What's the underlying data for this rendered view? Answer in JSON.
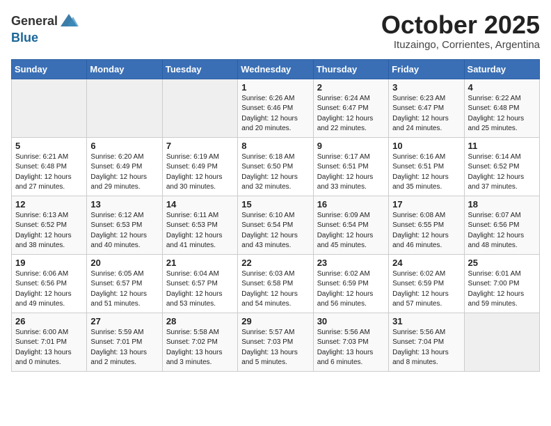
{
  "header": {
    "logo_general": "General",
    "logo_blue": "Blue",
    "month": "October 2025",
    "location": "Ituzaingo, Corrientes, Argentina"
  },
  "days_of_week": [
    "Sunday",
    "Monday",
    "Tuesday",
    "Wednesday",
    "Thursday",
    "Friday",
    "Saturday"
  ],
  "weeks": [
    [
      {
        "day": "",
        "info": ""
      },
      {
        "day": "",
        "info": ""
      },
      {
        "day": "",
        "info": ""
      },
      {
        "day": "1",
        "info": "Sunrise: 6:26 AM\nSunset: 6:46 PM\nDaylight: 12 hours\nand 20 minutes."
      },
      {
        "day": "2",
        "info": "Sunrise: 6:24 AM\nSunset: 6:47 PM\nDaylight: 12 hours\nand 22 minutes."
      },
      {
        "day": "3",
        "info": "Sunrise: 6:23 AM\nSunset: 6:47 PM\nDaylight: 12 hours\nand 24 minutes."
      },
      {
        "day": "4",
        "info": "Sunrise: 6:22 AM\nSunset: 6:48 PM\nDaylight: 12 hours\nand 25 minutes."
      }
    ],
    [
      {
        "day": "5",
        "info": "Sunrise: 6:21 AM\nSunset: 6:48 PM\nDaylight: 12 hours\nand 27 minutes."
      },
      {
        "day": "6",
        "info": "Sunrise: 6:20 AM\nSunset: 6:49 PM\nDaylight: 12 hours\nand 29 minutes."
      },
      {
        "day": "7",
        "info": "Sunrise: 6:19 AM\nSunset: 6:49 PM\nDaylight: 12 hours\nand 30 minutes."
      },
      {
        "day": "8",
        "info": "Sunrise: 6:18 AM\nSunset: 6:50 PM\nDaylight: 12 hours\nand 32 minutes."
      },
      {
        "day": "9",
        "info": "Sunrise: 6:17 AM\nSunset: 6:51 PM\nDaylight: 12 hours\nand 33 minutes."
      },
      {
        "day": "10",
        "info": "Sunrise: 6:16 AM\nSunset: 6:51 PM\nDaylight: 12 hours\nand 35 minutes."
      },
      {
        "day": "11",
        "info": "Sunrise: 6:14 AM\nSunset: 6:52 PM\nDaylight: 12 hours\nand 37 minutes."
      }
    ],
    [
      {
        "day": "12",
        "info": "Sunrise: 6:13 AM\nSunset: 6:52 PM\nDaylight: 12 hours\nand 38 minutes."
      },
      {
        "day": "13",
        "info": "Sunrise: 6:12 AM\nSunset: 6:53 PM\nDaylight: 12 hours\nand 40 minutes."
      },
      {
        "day": "14",
        "info": "Sunrise: 6:11 AM\nSunset: 6:53 PM\nDaylight: 12 hours\nand 41 minutes."
      },
      {
        "day": "15",
        "info": "Sunrise: 6:10 AM\nSunset: 6:54 PM\nDaylight: 12 hours\nand 43 minutes."
      },
      {
        "day": "16",
        "info": "Sunrise: 6:09 AM\nSunset: 6:54 PM\nDaylight: 12 hours\nand 45 minutes."
      },
      {
        "day": "17",
        "info": "Sunrise: 6:08 AM\nSunset: 6:55 PM\nDaylight: 12 hours\nand 46 minutes."
      },
      {
        "day": "18",
        "info": "Sunrise: 6:07 AM\nSunset: 6:56 PM\nDaylight: 12 hours\nand 48 minutes."
      }
    ],
    [
      {
        "day": "19",
        "info": "Sunrise: 6:06 AM\nSunset: 6:56 PM\nDaylight: 12 hours\nand 49 minutes."
      },
      {
        "day": "20",
        "info": "Sunrise: 6:05 AM\nSunset: 6:57 PM\nDaylight: 12 hours\nand 51 minutes."
      },
      {
        "day": "21",
        "info": "Sunrise: 6:04 AM\nSunset: 6:57 PM\nDaylight: 12 hours\nand 53 minutes."
      },
      {
        "day": "22",
        "info": "Sunrise: 6:03 AM\nSunset: 6:58 PM\nDaylight: 12 hours\nand 54 minutes."
      },
      {
        "day": "23",
        "info": "Sunrise: 6:02 AM\nSunset: 6:59 PM\nDaylight: 12 hours\nand 56 minutes."
      },
      {
        "day": "24",
        "info": "Sunrise: 6:02 AM\nSunset: 6:59 PM\nDaylight: 12 hours\nand 57 minutes."
      },
      {
        "day": "25",
        "info": "Sunrise: 6:01 AM\nSunset: 7:00 PM\nDaylight: 12 hours\nand 59 minutes."
      }
    ],
    [
      {
        "day": "26",
        "info": "Sunrise: 6:00 AM\nSunset: 7:01 PM\nDaylight: 13 hours\nand 0 minutes."
      },
      {
        "day": "27",
        "info": "Sunrise: 5:59 AM\nSunset: 7:01 PM\nDaylight: 13 hours\nand 2 minutes."
      },
      {
        "day": "28",
        "info": "Sunrise: 5:58 AM\nSunset: 7:02 PM\nDaylight: 13 hours\nand 3 minutes."
      },
      {
        "day": "29",
        "info": "Sunrise: 5:57 AM\nSunset: 7:03 PM\nDaylight: 13 hours\nand 5 minutes."
      },
      {
        "day": "30",
        "info": "Sunrise: 5:56 AM\nSunset: 7:03 PM\nDaylight: 13 hours\nand 6 minutes."
      },
      {
        "day": "31",
        "info": "Sunrise: 5:56 AM\nSunset: 7:04 PM\nDaylight: 13 hours\nand 8 minutes."
      },
      {
        "day": "",
        "info": ""
      }
    ]
  ]
}
